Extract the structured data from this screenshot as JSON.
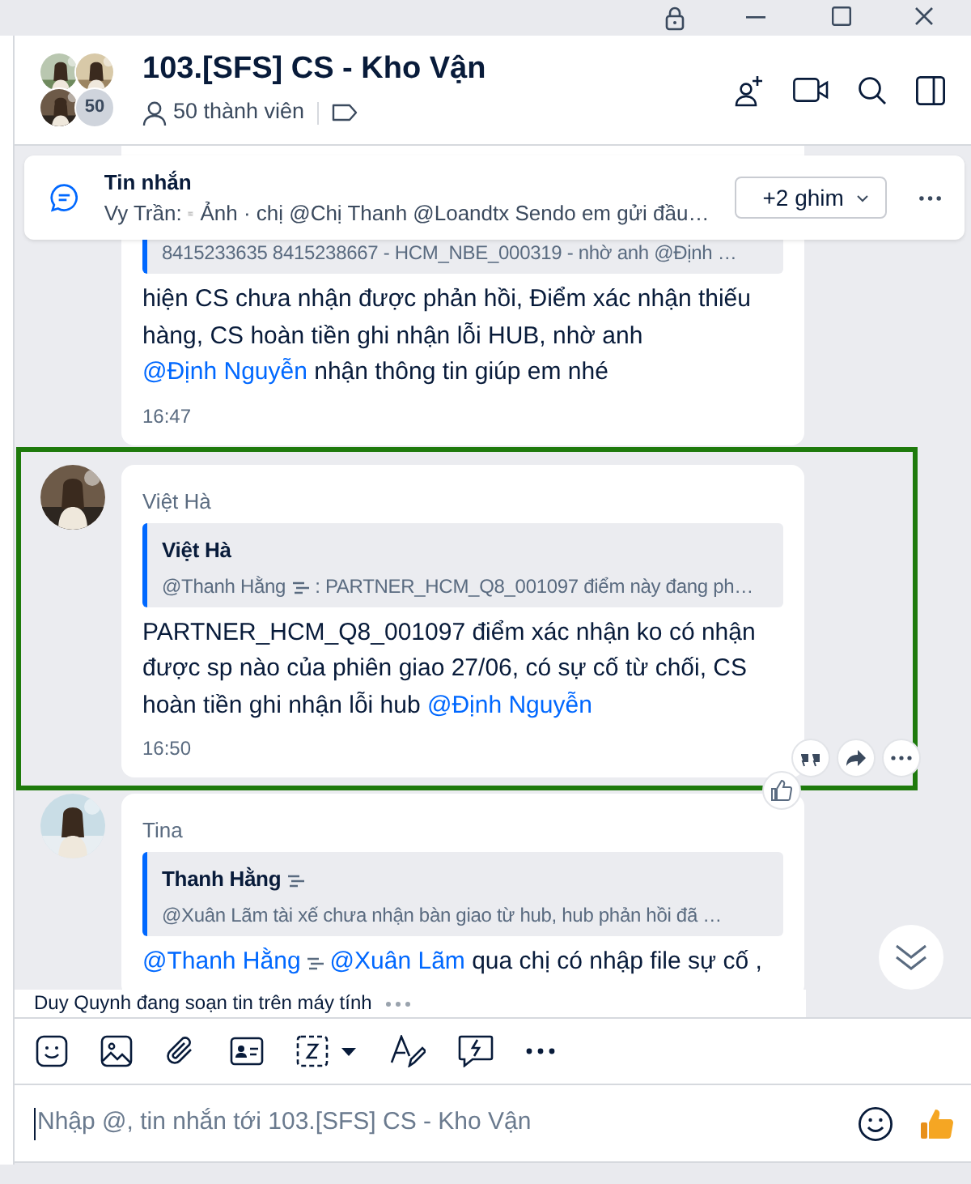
{
  "header": {
    "title": "103.[SFS] CS - Kho Vận",
    "member_count": "50 thành viên",
    "avatar_overflow": "50"
  },
  "pinned": {
    "title": "Tin nhắn",
    "sender": "Vy Trần:",
    "preview": "Ảnh · chị @Chị Thanh @Loandtx Sendo em gửi đầu…",
    "pin_count": "+2 ghim"
  },
  "messages": [
    {
      "highlighted": false,
      "hovered": false,
      "quote": {
        "text": [
          {
            "kind": "text",
            "text": "8415233635 8415238667 - HCM_NBE_000319 - nhờ anh @Định …"
          }
        ]
      },
      "body": [
        {
          "kind": "text",
          "text": "hiện CS chưa nhận được phản hồi, Điểm xác nhận thiếu hàng, CS hoàn tiền ghi nhận lỗi HUB, nhờ anh "
        },
        {
          "kind": "mention",
          "text": "@Định Nguyễn"
        },
        {
          "kind": "text",
          "text": " nhận thông tin giúp em nhé"
        }
      ],
      "time": "16:47"
    },
    {
      "highlighted": true,
      "hovered": true,
      "avatar": {
        "kind": "picture"
      },
      "sender": "Việt Hà",
      "quote": {
        "author": "Việt Hà",
        "text": [
          {
            "kind": "text",
            "text": "@Thanh Hằng"
          },
          {
            "kind": "icon"
          },
          {
            "kind": "text",
            "text": ": PARTNER_HCM_Q8_001097 điểm này đang ph…"
          }
        ]
      },
      "body": [
        {
          "kind": "text",
          "text": "PARTNER_HCM_Q8_001097 điểm xác nhận ko có nhận được sp nào của phiên giao 27/06, có sự cố từ chối, CS hoàn tiền ghi nhận lỗi hub "
        },
        {
          "kind": "mention",
          "text": "@Định Nguyễn"
        }
      ],
      "time": "16:50"
    },
    {
      "highlighted": false,
      "hovered": false,
      "avatar": {
        "kind": "picture"
      },
      "sender": "Tina",
      "quote": {
        "author": "Thanh Hằng",
        "author_icon": true,
        "text": [
          {
            "kind": "text",
            "text": "@Xuân Lãm tài xế chưa nhận bàn giao từ hub, hub phản hồi đã …"
          }
        ]
      },
      "body": [
        {
          "kind": "mention",
          "text": "@Thanh Hằng"
        },
        {
          "kind": "icon"
        },
        {
          "kind": "mention",
          "text": "@Xuân Lãm"
        },
        {
          "kind": "text",
          "text": " qua chị có nhập file sự cố ,"
        }
      ]
    }
  ],
  "typing_indicator": "Duy Quynh đang soạn tin trên máy tính",
  "composer": {
    "placeholder": "Nhập @, tin nhắn tới 103.[SFS] CS - Kho Vận"
  }
}
